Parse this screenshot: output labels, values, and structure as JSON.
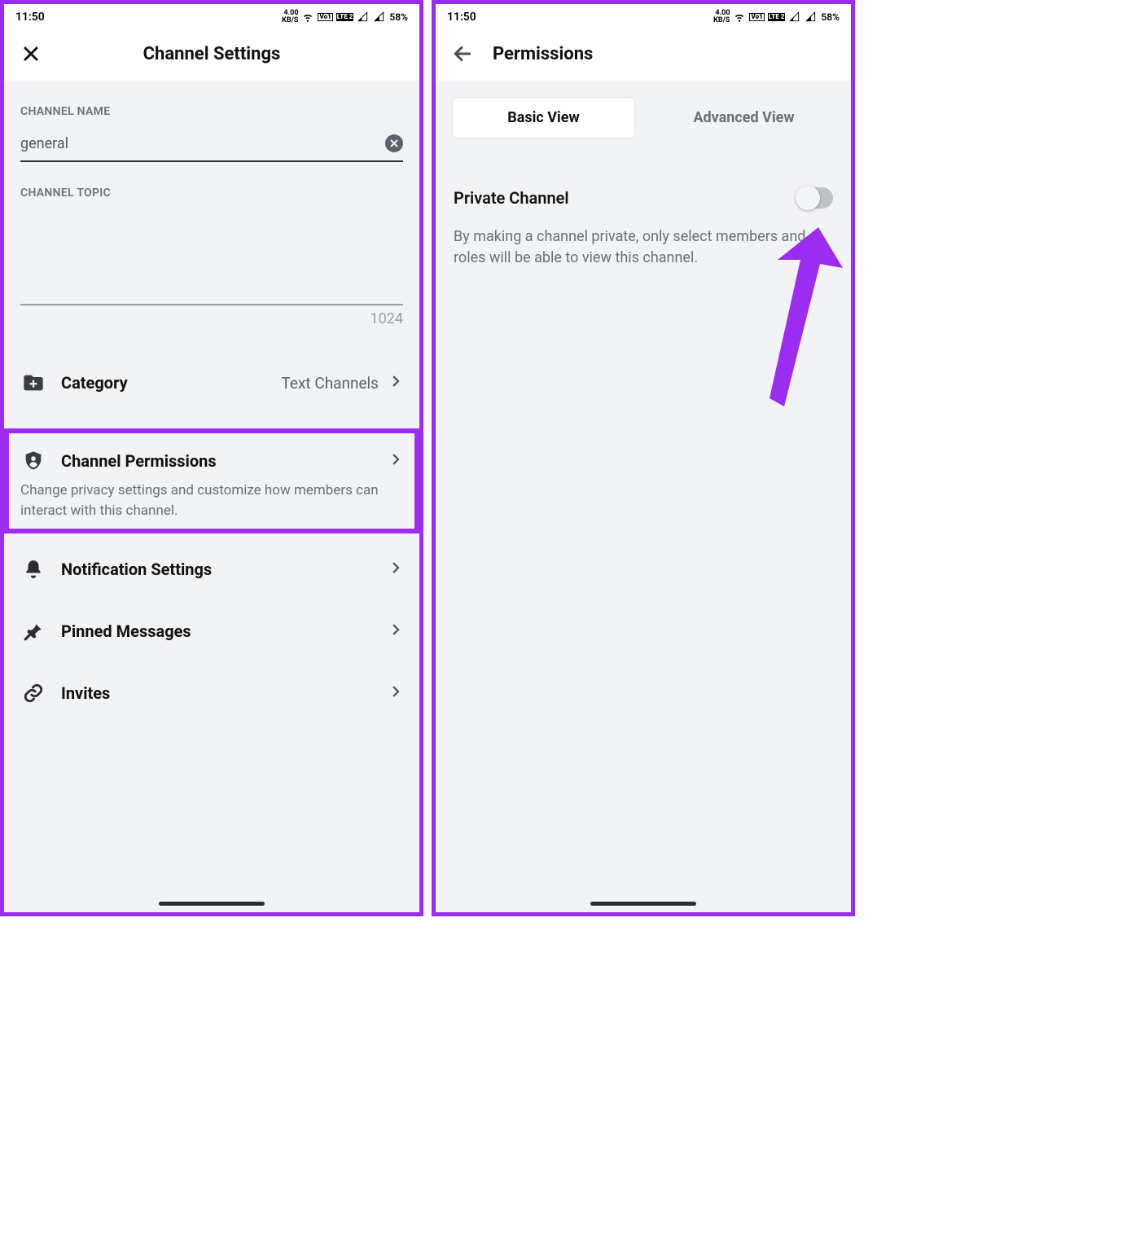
{
  "status": {
    "time": "11:50",
    "kbs": "4.00",
    "kbsu": "KB/S",
    "lte1": "Vo1",
    "lte2": "LTE 2",
    "battery": "58%"
  },
  "left": {
    "title": "Channel Settings",
    "name_label": "CHANNEL NAME",
    "name_value": "general",
    "topic_label": "CHANNEL TOPIC",
    "topic_counter": "1024",
    "rows": {
      "category": {
        "label": "Category",
        "value": "Text Channels"
      },
      "permissions": {
        "label": "Channel Permissions",
        "desc": "Change privacy settings and customize how members can interact with this channel."
      },
      "notifications": {
        "label": "Notification Settings"
      },
      "pinned": {
        "label": "Pinned Messages"
      },
      "invites": {
        "label": "Invites"
      }
    }
  },
  "right": {
    "title": "Permissions",
    "tabs": {
      "basic": "Basic View",
      "advanced": "Advanced View"
    },
    "private": {
      "label": "Private Channel",
      "desc": "By making a channel private, only select members and roles will be able to view this channel."
    }
  }
}
